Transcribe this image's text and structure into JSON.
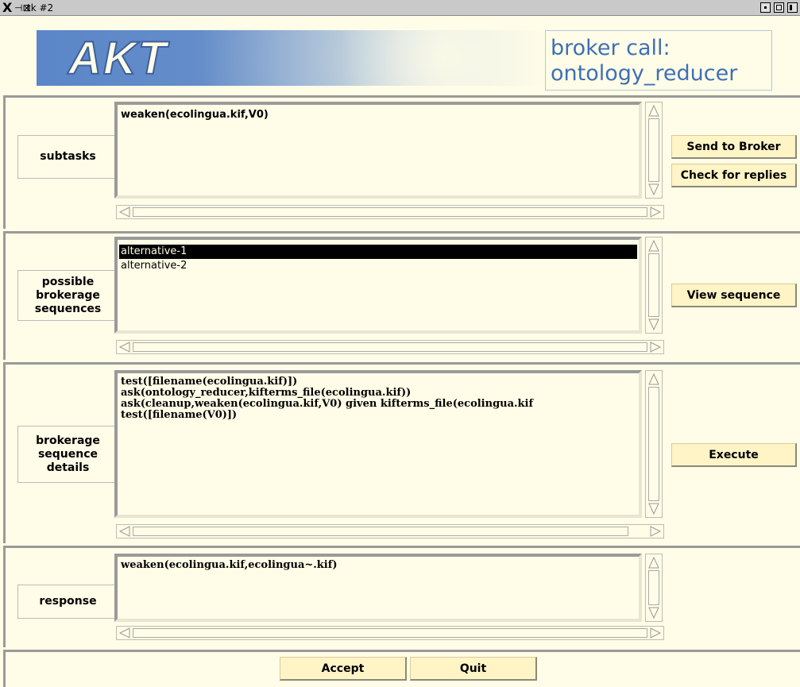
{
  "window": {
    "title": "tk #2"
  },
  "header": {
    "logo_text": "AKT",
    "broker_title_line1": "broker call:",
    "broker_title_line2": "ontology_reducer"
  },
  "subtasks": {
    "label": "subtasks",
    "lines": [
      "weaken(ecolingua.kif,V0)"
    ],
    "buttons": {
      "send": "Send to Broker",
      "check": "Check for replies"
    }
  },
  "sequences": {
    "label": "possible\nbrokerage\nsequences",
    "items": [
      "alternative-1",
      "alternative-2"
    ],
    "selected_index": 0,
    "buttons": {
      "view": "View sequence"
    }
  },
  "details": {
    "label": "brokerage\nsequence\ndetails",
    "lines": [
      "test([filename(ecolingua.kif)])",
      "ask(ontology_reducer,kifterms_file(ecolingua.kif))",
      "ask(cleanup,weaken(ecolingua.kif,V0) given kifterms_file(ecolingua.kif",
      "test([filename(V0)])"
    ],
    "buttons": {
      "execute": "Execute"
    }
  },
  "response": {
    "label": "response",
    "lines": [
      "weaken(ecolingua.kif,ecolingua~.kif)"
    ]
  },
  "footer": {
    "accept": "Accept",
    "quit": "Quit"
  },
  "colors": {
    "background": "#fffde7",
    "button": "#fff4c6",
    "title_blue": "#3f6fb7",
    "logo_blue": "#5b86c7"
  },
  "icons": [
    "x-window-icon",
    "pin-icon",
    "minimize-icon",
    "maximize-icon",
    "close-icon",
    "scroll-up-arrow-icon",
    "scroll-down-arrow-icon",
    "scroll-left-arrow-icon",
    "scroll-right-arrow-icon"
  ]
}
